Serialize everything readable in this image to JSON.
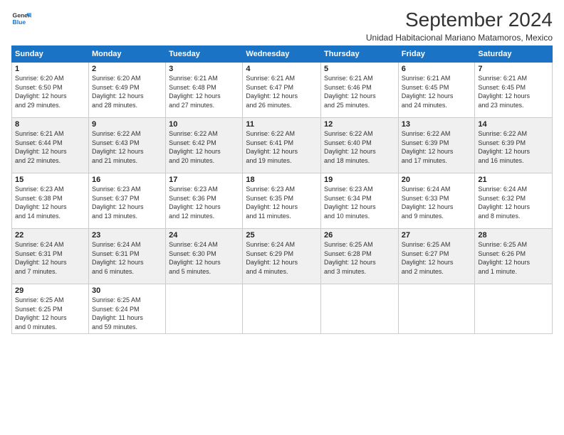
{
  "logo": {
    "line1": "General",
    "line2": "Blue"
  },
  "title": "September 2024",
  "subtitle": "Unidad Habitacional Mariano Matamoros, Mexico",
  "headers": [
    "Sunday",
    "Monday",
    "Tuesday",
    "Wednesday",
    "Thursday",
    "Friday",
    "Saturday"
  ],
  "weeks": [
    [
      {
        "day": "1",
        "info": "Sunrise: 6:20 AM\nSunset: 6:50 PM\nDaylight: 12 hours\nand 29 minutes."
      },
      {
        "day": "2",
        "info": "Sunrise: 6:20 AM\nSunset: 6:49 PM\nDaylight: 12 hours\nand 28 minutes."
      },
      {
        "day": "3",
        "info": "Sunrise: 6:21 AM\nSunset: 6:48 PM\nDaylight: 12 hours\nand 27 minutes."
      },
      {
        "day": "4",
        "info": "Sunrise: 6:21 AM\nSunset: 6:47 PM\nDaylight: 12 hours\nand 26 minutes."
      },
      {
        "day": "5",
        "info": "Sunrise: 6:21 AM\nSunset: 6:46 PM\nDaylight: 12 hours\nand 25 minutes."
      },
      {
        "day": "6",
        "info": "Sunrise: 6:21 AM\nSunset: 6:45 PM\nDaylight: 12 hours\nand 24 minutes."
      },
      {
        "day": "7",
        "info": "Sunrise: 6:21 AM\nSunset: 6:45 PM\nDaylight: 12 hours\nand 23 minutes."
      }
    ],
    [
      {
        "day": "8",
        "info": "Sunrise: 6:21 AM\nSunset: 6:44 PM\nDaylight: 12 hours\nand 22 minutes."
      },
      {
        "day": "9",
        "info": "Sunrise: 6:22 AM\nSunset: 6:43 PM\nDaylight: 12 hours\nand 21 minutes."
      },
      {
        "day": "10",
        "info": "Sunrise: 6:22 AM\nSunset: 6:42 PM\nDaylight: 12 hours\nand 20 minutes."
      },
      {
        "day": "11",
        "info": "Sunrise: 6:22 AM\nSunset: 6:41 PM\nDaylight: 12 hours\nand 19 minutes."
      },
      {
        "day": "12",
        "info": "Sunrise: 6:22 AM\nSunset: 6:40 PM\nDaylight: 12 hours\nand 18 minutes."
      },
      {
        "day": "13",
        "info": "Sunrise: 6:22 AM\nSunset: 6:39 PM\nDaylight: 12 hours\nand 17 minutes."
      },
      {
        "day": "14",
        "info": "Sunrise: 6:22 AM\nSunset: 6:39 PM\nDaylight: 12 hours\nand 16 minutes."
      }
    ],
    [
      {
        "day": "15",
        "info": "Sunrise: 6:23 AM\nSunset: 6:38 PM\nDaylight: 12 hours\nand 14 minutes."
      },
      {
        "day": "16",
        "info": "Sunrise: 6:23 AM\nSunset: 6:37 PM\nDaylight: 12 hours\nand 13 minutes."
      },
      {
        "day": "17",
        "info": "Sunrise: 6:23 AM\nSunset: 6:36 PM\nDaylight: 12 hours\nand 12 minutes."
      },
      {
        "day": "18",
        "info": "Sunrise: 6:23 AM\nSunset: 6:35 PM\nDaylight: 12 hours\nand 11 minutes."
      },
      {
        "day": "19",
        "info": "Sunrise: 6:23 AM\nSunset: 6:34 PM\nDaylight: 12 hours\nand 10 minutes."
      },
      {
        "day": "20",
        "info": "Sunrise: 6:24 AM\nSunset: 6:33 PM\nDaylight: 12 hours\nand 9 minutes."
      },
      {
        "day": "21",
        "info": "Sunrise: 6:24 AM\nSunset: 6:32 PM\nDaylight: 12 hours\nand 8 minutes."
      }
    ],
    [
      {
        "day": "22",
        "info": "Sunrise: 6:24 AM\nSunset: 6:31 PM\nDaylight: 12 hours\nand 7 minutes."
      },
      {
        "day": "23",
        "info": "Sunrise: 6:24 AM\nSunset: 6:31 PM\nDaylight: 12 hours\nand 6 minutes."
      },
      {
        "day": "24",
        "info": "Sunrise: 6:24 AM\nSunset: 6:30 PM\nDaylight: 12 hours\nand 5 minutes."
      },
      {
        "day": "25",
        "info": "Sunrise: 6:24 AM\nSunset: 6:29 PM\nDaylight: 12 hours\nand 4 minutes."
      },
      {
        "day": "26",
        "info": "Sunrise: 6:25 AM\nSunset: 6:28 PM\nDaylight: 12 hours\nand 3 minutes."
      },
      {
        "day": "27",
        "info": "Sunrise: 6:25 AM\nSunset: 6:27 PM\nDaylight: 12 hours\nand 2 minutes."
      },
      {
        "day": "28",
        "info": "Sunrise: 6:25 AM\nSunset: 6:26 PM\nDaylight: 12 hours\nand 1 minute."
      }
    ],
    [
      {
        "day": "29",
        "info": "Sunrise: 6:25 AM\nSunset: 6:25 PM\nDaylight: 12 hours\nand 0 minutes."
      },
      {
        "day": "30",
        "info": "Sunrise: 6:25 AM\nSunset: 6:24 PM\nDaylight: 11 hours\nand 59 minutes."
      },
      null,
      null,
      null,
      null,
      null
    ]
  ]
}
